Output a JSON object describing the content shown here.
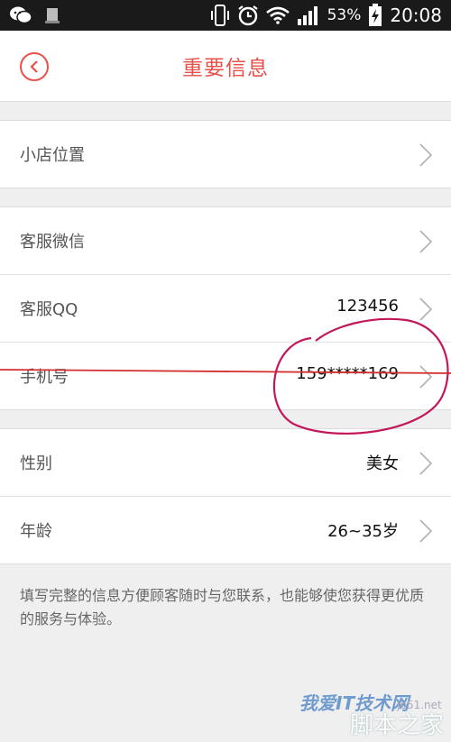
{
  "status_bar": {
    "battery_percent": "53%",
    "time": "20:08",
    "icons": [
      "wechat-icon",
      "notification-icon",
      "vibrate-icon",
      "alarm-icon",
      "wifi-icon",
      "signal-icon",
      "battery-charging-icon"
    ]
  },
  "header": {
    "title": "重要信息",
    "back_icon": "back-chevron-icon"
  },
  "groups": [
    {
      "rows": [
        {
          "label": "小店位置",
          "value": ""
        }
      ]
    },
    {
      "rows": [
        {
          "label": "客服微信",
          "value": ""
        },
        {
          "label": "客服QQ",
          "value": "123456"
        },
        {
          "label": "手机号",
          "value": "159*****169"
        }
      ]
    },
    {
      "rows": [
        {
          "label": "性别",
          "value": "美女"
        },
        {
          "label": "年龄",
          "value": "26~35岁"
        }
      ]
    }
  ],
  "hint": "填写完整的信息方便顾客随时与您联系，也能够使您获得更优质的服务与体验。",
  "watermark": {
    "brand": "我爱IT技术网",
    "site": "jb51.net",
    "text": "脚本之家"
  },
  "colors": {
    "accent": "#e8514a",
    "annotation": "#c2185b"
  }
}
